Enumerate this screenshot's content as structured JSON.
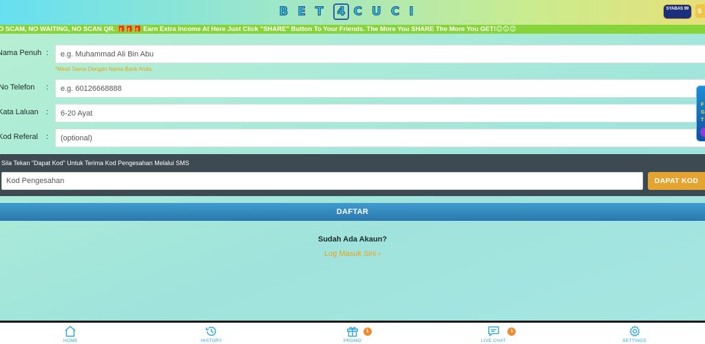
{
  "header": {
    "logo_text": "BET4CUCI",
    "logo_prefix": "BET",
    "logo_four": "4",
    "logo_suffix": "CUCI",
    "sponsor_badge": "SYABAS 99",
    "lang_button": "S"
  },
  "marquee": {
    "text": "O SCAM, NO WAITING, NO SCAN QR. 🎁🎁🎁 Earn Extra Income At Here Just Click \"SHARE\" Button To Your Friends. The More You SHARE The More You GET!😊😊😊"
  },
  "form": {
    "full_name": {
      "label": "Nama Penuh",
      "placeholder": "e.g. Muhammad Ali Bin Abu",
      "hint": "*Mesti Sama Dengan Nama Bank Anda."
    },
    "phone": {
      "label": "No Telefon",
      "placeholder": "e.g. 60126668888"
    },
    "password": {
      "label": "Kata Laluan",
      "placeholder": "6-20 Ayat"
    },
    "referral": {
      "label": "Kod Referal",
      "placeholder": "(optional)"
    },
    "colon": ":"
  },
  "side_ad": {
    "line1": "F",
    "line2": "GA",
    "line3": "T"
  },
  "sms": {
    "title": "Sila Tekan \"Dapat Kod\" Untuk Terima Kod Pengesahan Melalui SMS",
    "code_placeholder": "Kod Pengesahan",
    "get_code_label": "DAPAT KOD"
  },
  "register_label": "DAFTAR",
  "have_account_text": "Sudah Ada Akaun?",
  "login_link_text": "Log Masuk Sini ›",
  "bottom_nav": {
    "items": [
      {
        "label": "HOME",
        "icon": "home-icon"
      },
      {
        "label": "HISTORY",
        "icon": "history-icon"
      },
      {
        "label": "PROMO",
        "icon": "gift-icon",
        "badge": "1"
      },
      {
        "label": "LIVE CHAT",
        "icon": "chat-icon",
        "badge": "1"
      },
      {
        "label": "SETTINGS",
        "icon": "gear-icon"
      }
    ]
  },
  "colors": {
    "accent_orange": "#e3a52f",
    "nav_blue": "#2aa6d8",
    "register_blue": "#2a78ad",
    "marquee_green": "#86d33a",
    "panel_dark": "#3d4a52"
  }
}
